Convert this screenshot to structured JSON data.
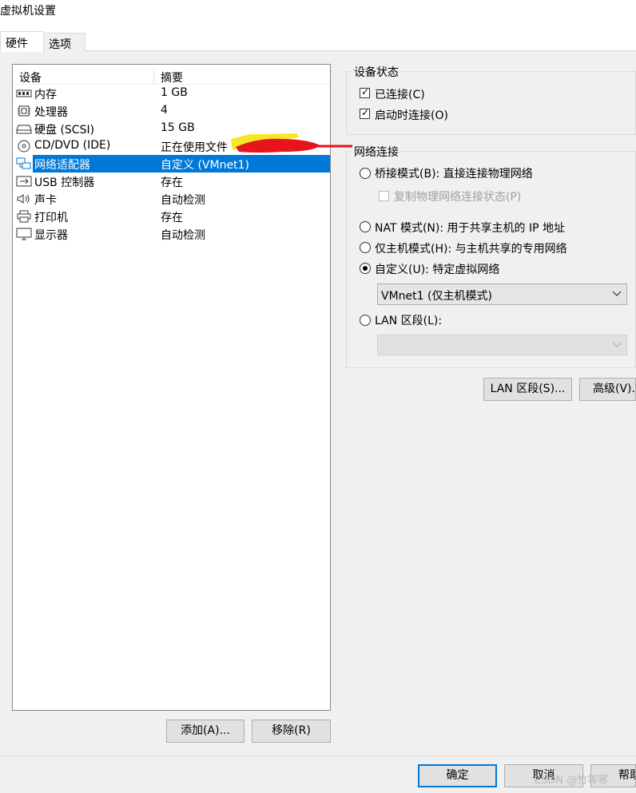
{
  "window": {
    "title": "虚拟机设置"
  },
  "tabs": [
    {
      "label": "硬件"
    },
    {
      "label": "选项"
    }
  ],
  "device_list": {
    "col_device": "设备",
    "col_summary": "摘要",
    "rows": [
      {
        "name": "内存",
        "summary": "1 GB",
        "icon": "memory-icon"
      },
      {
        "name": "处理器",
        "summary": "4",
        "icon": "processor-icon"
      },
      {
        "name": "硬盘 (SCSI)",
        "summary": "15 GB",
        "icon": "hard-disk-icon"
      },
      {
        "name": "CD/DVD (IDE)",
        "summary": "正在使用文件",
        "icon": "cd-dvd-icon"
      },
      {
        "name": "网络适配器",
        "summary": "自定义 (VMnet1)",
        "icon": "network-adapter-icon",
        "selected": true
      },
      {
        "name": "USB 控制器",
        "summary": "存在",
        "icon": "usb-icon"
      },
      {
        "name": "声卡",
        "summary": "自动检测",
        "icon": "sound-card-icon"
      },
      {
        "name": "打印机",
        "summary": "存在",
        "icon": "printer-icon"
      },
      {
        "name": "显示器",
        "summary": "自动检测",
        "icon": "display-icon"
      }
    ],
    "add_button": "添加(A)...",
    "remove_button": "移除(R)"
  },
  "device_status": {
    "label": "设备状态",
    "connected": {
      "label": "已连接(C)",
      "checked": true
    },
    "connect_on_power": {
      "label": "启动时连接(O)",
      "checked": true
    }
  },
  "network": {
    "label": "网络连接",
    "bridged": {
      "label": "桥接模式(B): 直接连接物理网络",
      "selected": false
    },
    "replicate": {
      "label": "复制物理网络连接状态(P)",
      "checked": false,
      "disabled": true
    },
    "nat": {
      "label": "NAT 模式(N): 用于共享主机的 IP 地址",
      "selected": false
    },
    "host_only": {
      "label": "仅主机模式(H): 与主机共享的专用网络",
      "selected": false
    },
    "custom": {
      "label": "自定义(U): 特定虚拟网络",
      "selected": true
    },
    "custom_select_value": "VMnet1 (仅主机模式)",
    "lan": {
      "label": "LAN 区段(L):",
      "selected": false
    },
    "lan_select_value": ""
  },
  "buttons": {
    "lan_segments": "LAN 区段(S)...",
    "advanced": "高级(V)..."
  },
  "footer": {
    "ok": "确定",
    "cancel": "取消",
    "help": "帮助"
  },
  "watermark": "CSDN @竹等寒",
  "colors": {
    "selection": "#0078d7",
    "annotation": "#e8141b",
    "highlight": "#f5e300"
  }
}
